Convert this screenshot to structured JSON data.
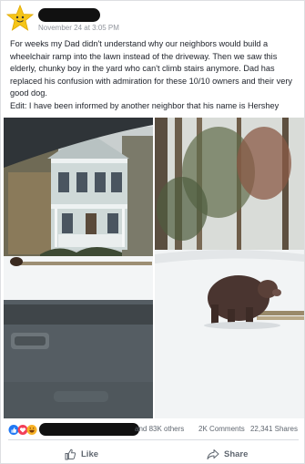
{
  "post": {
    "timestamp": "November 24 at 3:05 PM",
    "body": "For weeks my Dad didn't understand why our neighbors would build a wheelchair ramp into the lawn instead of the driveway. Then we saw this elderly, chunky boy in the yard who can't climb stairs anymore. Dad has replaced his confusion with admiration for these 10/10 owners and their very good dog.",
    "edit": "Edit: I have been informed by another neighbor that his name is Hershey"
  },
  "reactions": {
    "others": "and 83K others",
    "comments": "2K Comments",
    "shares": "22,341 Shares",
    "icons": [
      "like-icon",
      "love-icon",
      "haha-icon"
    ]
  },
  "actions": {
    "like": "Like",
    "share": "Share"
  },
  "colors": {
    "like_blue": "#2078f4",
    "love_red": "#f33e58",
    "haha_yellow": "#f7b125"
  }
}
